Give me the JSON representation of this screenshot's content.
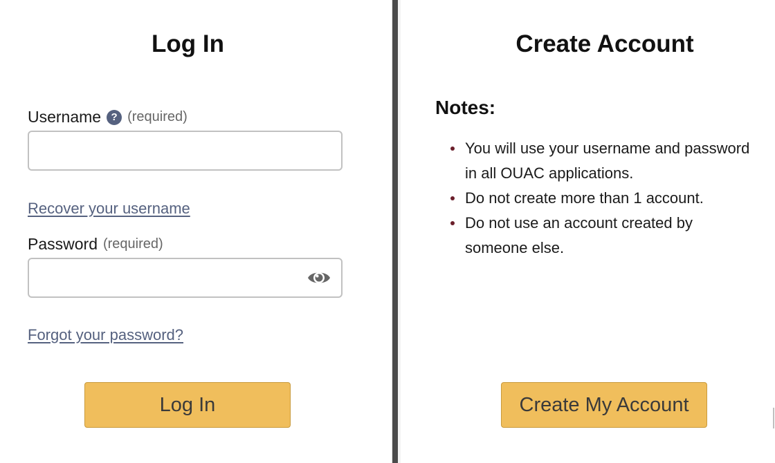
{
  "login": {
    "title": "Log In",
    "username_label": "Username",
    "username_required": "(required)",
    "username_help_icon": "?",
    "username_value": "",
    "recover_username_link": "Recover your username",
    "password_label": "Password",
    "password_required": "(required)",
    "password_value": "",
    "password_toggle_icon": "eye-icon",
    "forgot_password_link": "Forgot your password?",
    "submit_label": "Log In"
  },
  "create_account": {
    "title": "Create Account",
    "notes_heading": "Notes:",
    "notes": [
      "You will use your username and password\nin all OUAC applications.",
      "Do not create more than 1 account.",
      "Do not use an account created by\nsomeone else."
    ],
    "submit_label": "Create My Account"
  },
  "colors": {
    "button_bg": "#f0be5c",
    "link": "#55617f",
    "help_icon": "#55617f",
    "bullet": "#6b1f2b",
    "divider": "#4a4a4a"
  }
}
